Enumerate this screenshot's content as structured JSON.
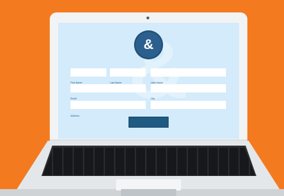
{
  "form": {
    "logo_text": "&",
    "labels": {
      "first_name": "First Name",
      "last_name": "Last Name",
      "user_name": "User Name",
      "email": "Email",
      "city": "City",
      "address": "Address"
    },
    "submit_label": ""
  },
  "colors": {
    "background": "#f47a20",
    "screen": "#d3ebfb",
    "accent": "#1f5a82"
  },
  "icons": {
    "logo": "ampersand-icon"
  }
}
